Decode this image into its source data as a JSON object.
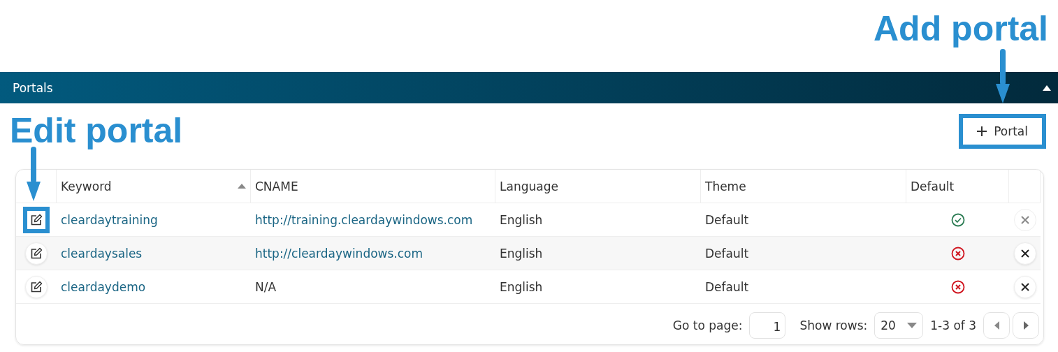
{
  "annotations": [
    {
      "kind": "add",
      "text": "Add portal"
    },
    {
      "kind": "edit",
      "text": "Edit portal"
    }
  ],
  "panel": {
    "title": "Portals",
    "collapsed": false
  },
  "add_button": {
    "label": "Portal",
    "highlighted": true
  },
  "table": {
    "columns": [
      {
        "label": "Keyword",
        "sorted": true
      },
      {
        "label": "CNAME",
        "sorted": false
      },
      {
        "label": "Language",
        "sorted": false
      },
      {
        "label": "Theme",
        "sorted": false
      },
      {
        "label": "Default",
        "sorted": false
      }
    ],
    "rows": [
      {
        "keyword": "cleardaytraining",
        "cname": "http://training.cleardaywindows.com",
        "cname_link": true,
        "language": "English",
        "theme": "Default",
        "default": true,
        "delete_disabled": true,
        "edit_highlighted": true
      },
      {
        "keyword": "cleardaysales",
        "cname": "http://cleardaywindows.com",
        "cname_link": true,
        "language": "English",
        "theme": "Default",
        "default": false,
        "delete_disabled": false,
        "edit_highlighted": false
      },
      {
        "keyword": "cleardaydemo",
        "cname": "N/A",
        "cname_link": false,
        "language": "English",
        "theme": "Default",
        "default": false,
        "delete_disabled": false,
        "edit_highlighted": false
      }
    ]
  },
  "pagination": {
    "goto_label": "Go to page:",
    "page": "1",
    "rows_label": "Show rows:",
    "rows_value": "20",
    "range": "1-3 of 3"
  }
}
